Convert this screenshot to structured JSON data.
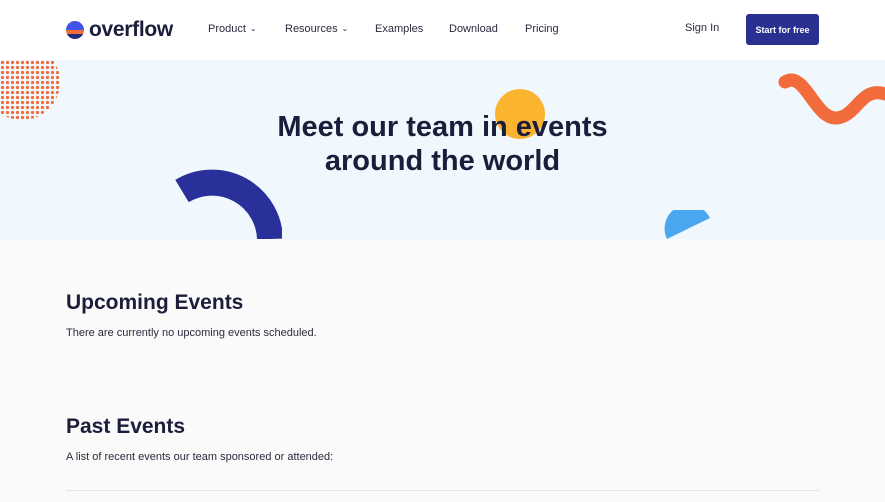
{
  "brand": {
    "name": "overflow",
    "colors": {
      "primary": "#29308f",
      "accent_orange": "#f26b3a",
      "accent_yellow": "#fbb430",
      "accent_blue": "#4aa8f0"
    }
  },
  "nav": {
    "items": [
      {
        "label": "Product",
        "has_dropdown": true
      },
      {
        "label": "Resources",
        "has_dropdown": true
      },
      {
        "label": "Examples"
      },
      {
        "label": "Download"
      },
      {
        "label": "Pricing"
      }
    ],
    "dropdown_icon": "chevron-down-icon",
    "signin_label": "Sign In",
    "cta_label": "Start for free"
  },
  "hero": {
    "title_line1": "Meet our team in events",
    "title_line2": "around the world"
  },
  "upcoming": {
    "title": "Upcoming Events",
    "text": "There are currently no upcoming events scheduled."
  },
  "past": {
    "title": "Past Events",
    "text": "A list of recent events our team sponsored or attended:"
  }
}
